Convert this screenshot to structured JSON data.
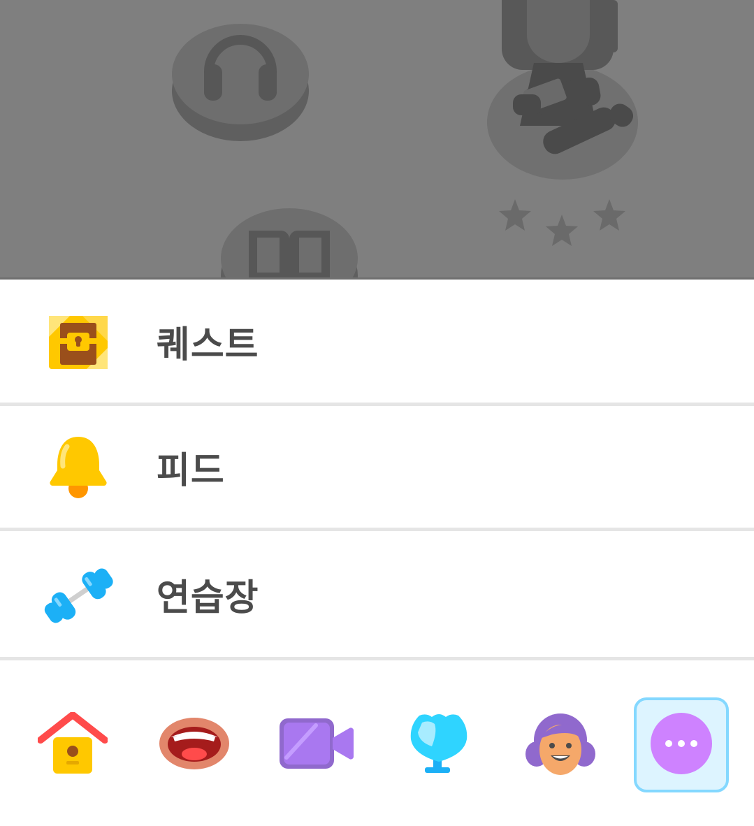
{
  "menu": {
    "items": [
      {
        "label": "퀘스트",
        "icon": "treasure-chest-icon"
      },
      {
        "label": "피드",
        "icon": "bell-icon"
      },
      {
        "label": "연습장",
        "icon": "dumbbell-icon"
      }
    ]
  },
  "tabbar": {
    "tabs": [
      {
        "icon": "house-icon",
        "active": false
      },
      {
        "icon": "mouth-icon",
        "active": false
      },
      {
        "icon": "video-camera-icon",
        "active": false
      },
      {
        "icon": "shield-icon",
        "active": false
      },
      {
        "icon": "profile-face-icon",
        "active": false
      },
      {
        "icon": "more-icon",
        "active": true
      }
    ]
  },
  "colors": {
    "overlay": "#7f7f7f",
    "text": "#4b4b4b",
    "divider": "#e5e5e5",
    "active_tab_bg": "#ddf4ff",
    "active_tab_border": "#84d8ff"
  }
}
